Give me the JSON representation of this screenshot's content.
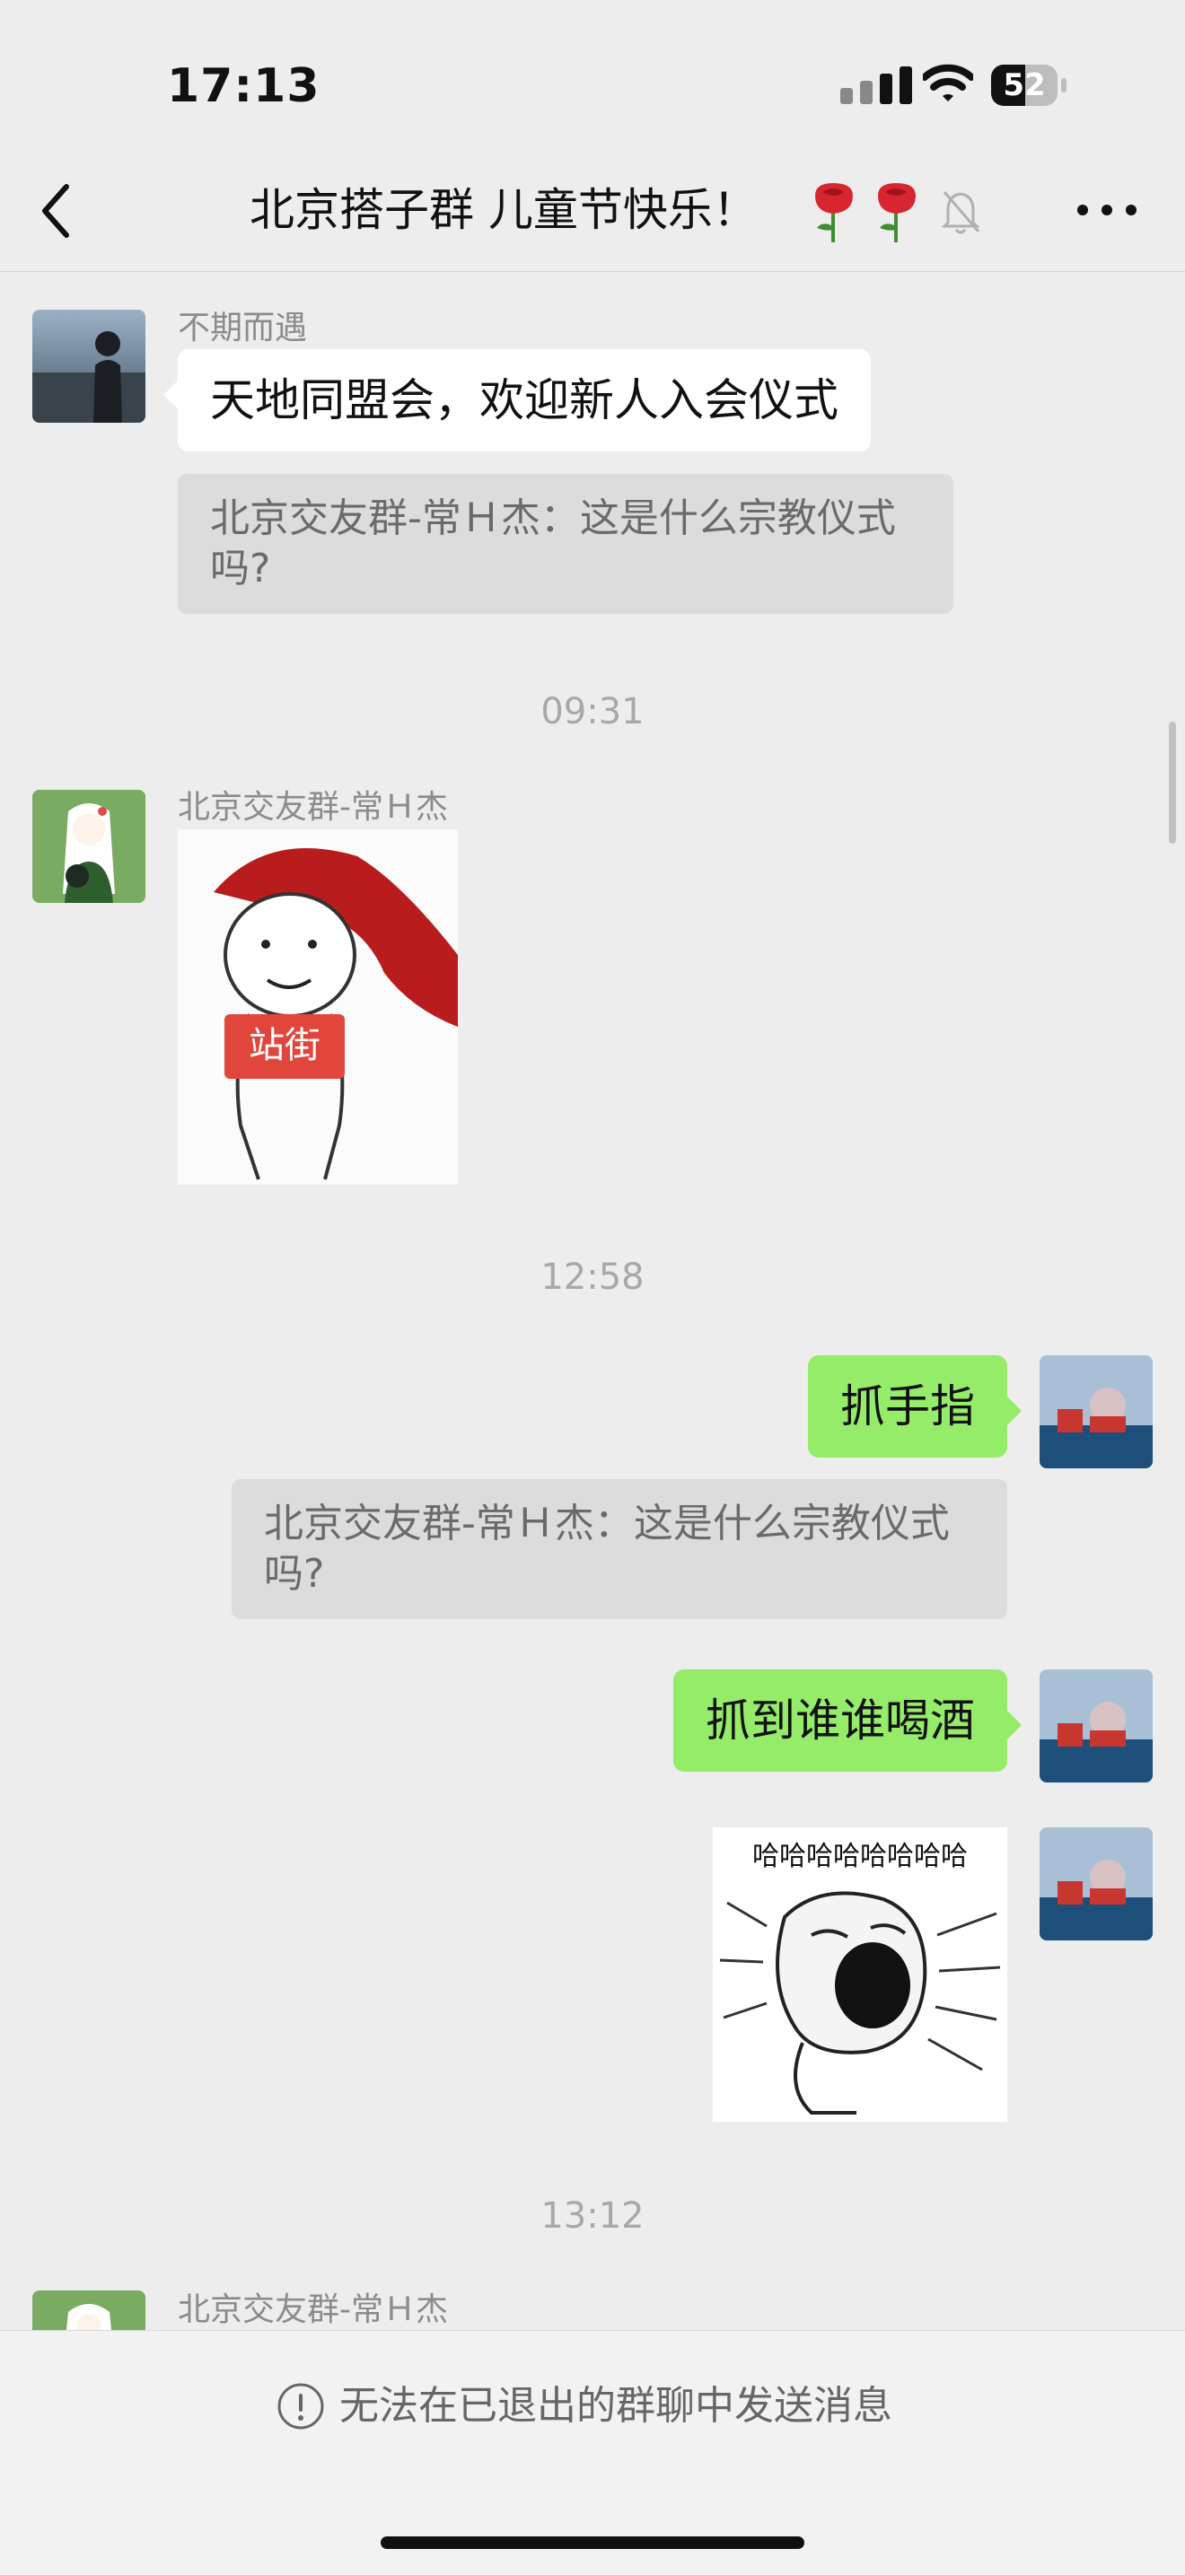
{
  "status_bar": {
    "time": "17:13",
    "battery_level": "52",
    "battery_fraction": 0.52
  },
  "header": {
    "title": "北京搭子群 儿童节快乐！",
    "emoji": "🌹🌹"
  },
  "messages": [
    {
      "sender": "不期而遇",
      "text": "天地同盟会，欢迎新人入会仪式",
      "quote": "北京交友群-常Ｈ杰：这是什么宗教仪式吗?"
    },
    {
      "timestamp": "09:31"
    },
    {
      "sender": "北京交友群-常Ｈ杰",
      "sticker_text": "站街"
    },
    {
      "timestamp": "12:58"
    },
    {
      "text": "抓手指",
      "quote": "北京交友群-常Ｈ杰：这是什么宗教仪式吗?"
    },
    {
      "text": "抓到谁谁喝酒"
    },
    {
      "sticker_text": "哈哈哈哈哈哈哈哈"
    },
    {
      "timestamp": "13:12"
    },
    {
      "sender": "北京交友群-常Ｈ杰"
    }
  ],
  "footer": {
    "notice": "无法在已退出的群聊中发送消息"
  },
  "icons": {
    "back": "chevron-left-icon",
    "mute": "bell-slash-icon",
    "more": "ellipsis-icon",
    "notice": "exclamation-circle-icon",
    "wifi": "wifi-icon",
    "signal": "signal-icon"
  },
  "colors": {
    "background": "#ededed",
    "bubble_self": "#95ec69",
    "bubble_other": "#ffffff",
    "quote": "#dcdcdc"
  }
}
